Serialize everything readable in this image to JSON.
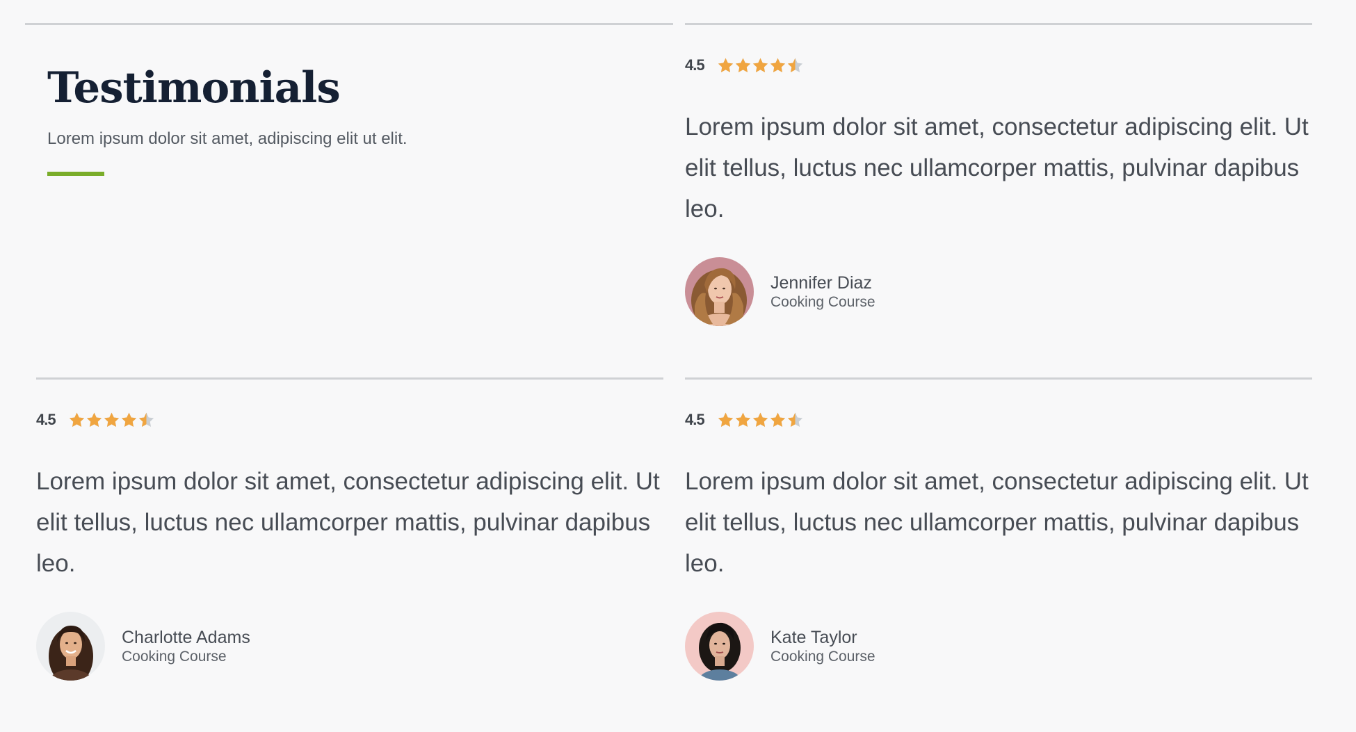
{
  "section": {
    "title": "Testimonials",
    "subtitle": "Lorem ipsum dolor sit amet, adipiscing elit ut elit."
  },
  "colors": {
    "accent": "#7aad2a",
    "star_fill": "#f0a540",
    "star_empty": "#c9ced3",
    "title": "#152033"
  },
  "testimonials": [
    {
      "rating": "4.5",
      "rating_value": 4.5,
      "rating_max": 5,
      "quote": "Lorem ipsum dolor sit amet, consectetur adipiscing elit. Ut elit tellus, luctus nec ullamcorper mattis, pulvinar dapibus leo.",
      "name": "Jennifer Diaz",
      "course": "Cooking Course",
      "avatar_icon": "avatar-photo"
    },
    {
      "rating": "4.5",
      "rating_value": 4.5,
      "rating_max": 5,
      "quote": "Lorem ipsum dolor sit amet, consectetur adipiscing elit. Ut elit tellus, luctus nec ullamcorper mattis, pulvinar dapibus leo.",
      "name": "Charlotte Adams",
      "course": "Cooking Course",
      "avatar_icon": "avatar-photo"
    },
    {
      "rating": "4.5",
      "rating_value": 4.5,
      "rating_max": 5,
      "quote": "Lorem ipsum dolor sit amet, consectetur adipiscing elit. Ut elit tellus, luctus nec ullamcorper mattis, pulvinar dapibus leo.",
      "name": "Kate Taylor",
      "course": "Cooking Course",
      "avatar_icon": "avatar-photo"
    }
  ]
}
